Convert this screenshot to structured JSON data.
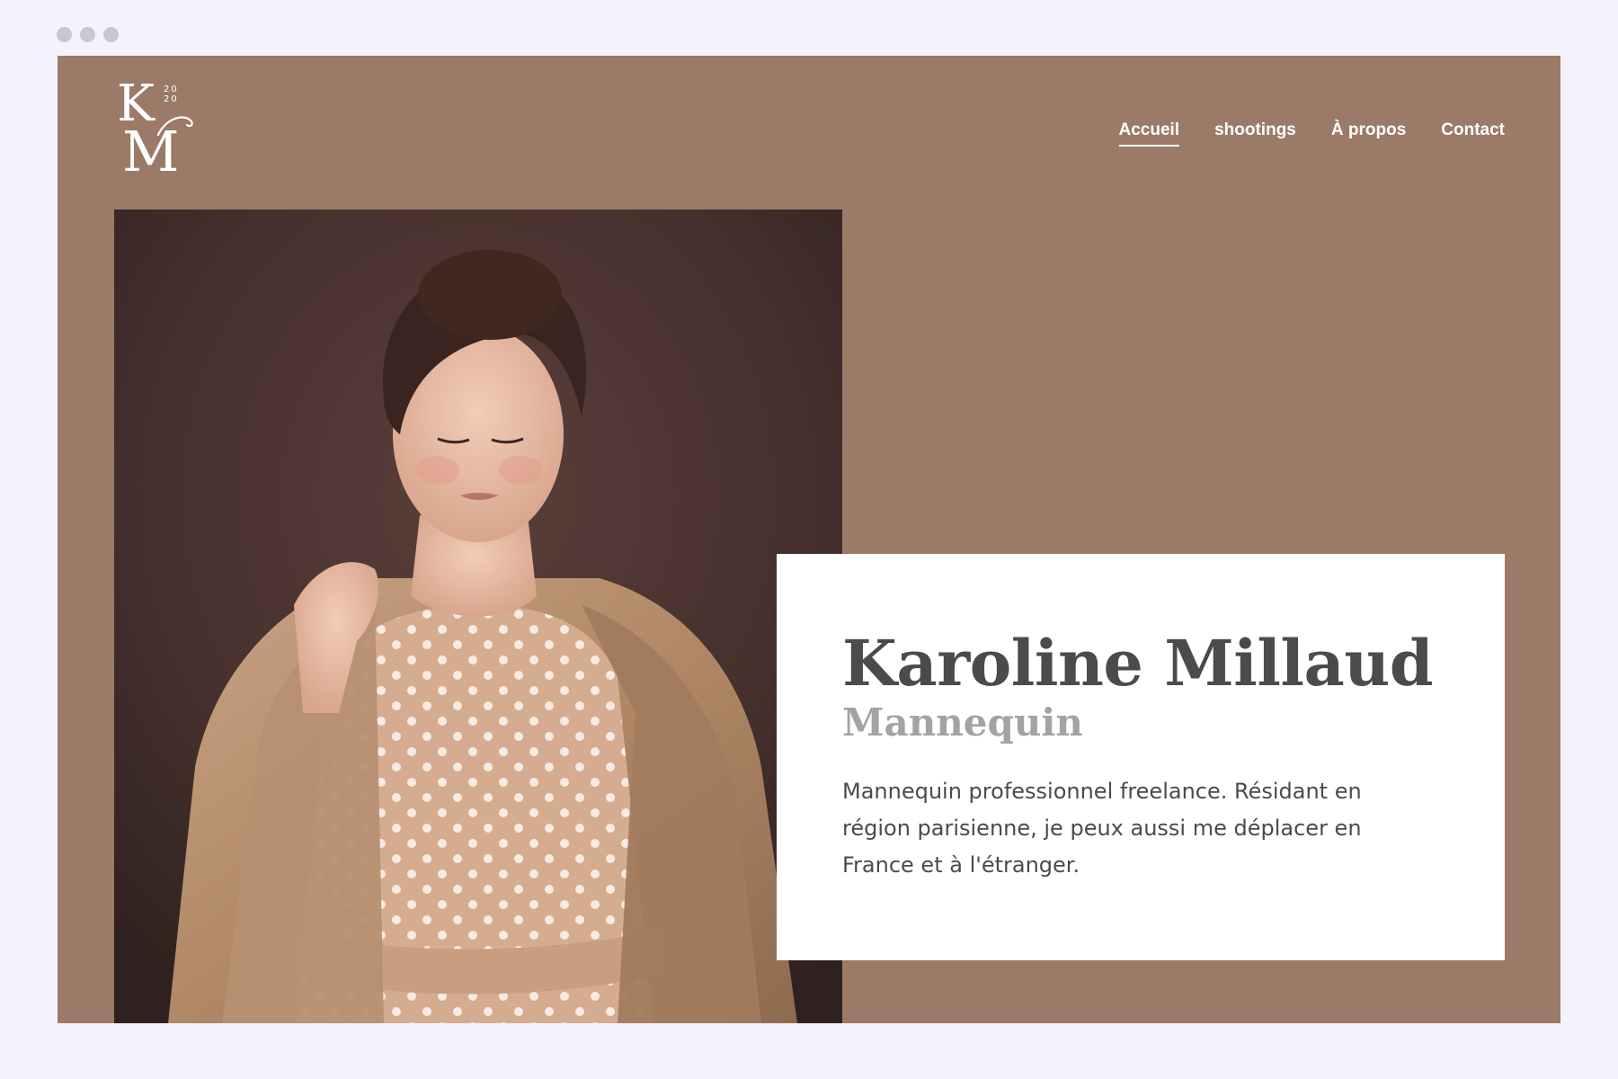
{
  "window": {
    "controls": [
      "dot",
      "dot",
      "dot"
    ]
  },
  "logo": {
    "letter_top": "K",
    "letter_bottom": "M",
    "year_top": "20",
    "year_bottom": "20"
  },
  "nav": {
    "items": [
      {
        "label": "Accueil",
        "active": true
      },
      {
        "label": "shootings",
        "active": false
      },
      {
        "label": "À propos",
        "active": false
      },
      {
        "label": "Contact",
        "active": false
      }
    ]
  },
  "hero": {
    "image": "portrait-photo",
    "name": "Karoline Millaud",
    "role": "Mannequin",
    "description": "Mannequin professionnel freelance. Résidant en région parisienne, je peux aussi me déplacer en France et à l'étranger."
  },
  "colors": {
    "page_background": "#f4f3fb",
    "site_background": "#9b7b67",
    "card_background": "#ffffff",
    "heading_text": "#4b4b4b",
    "subheading_text": "#a3a3a3",
    "nav_text": "#ffffff",
    "chrome_dot": "#c9c8d0"
  }
}
